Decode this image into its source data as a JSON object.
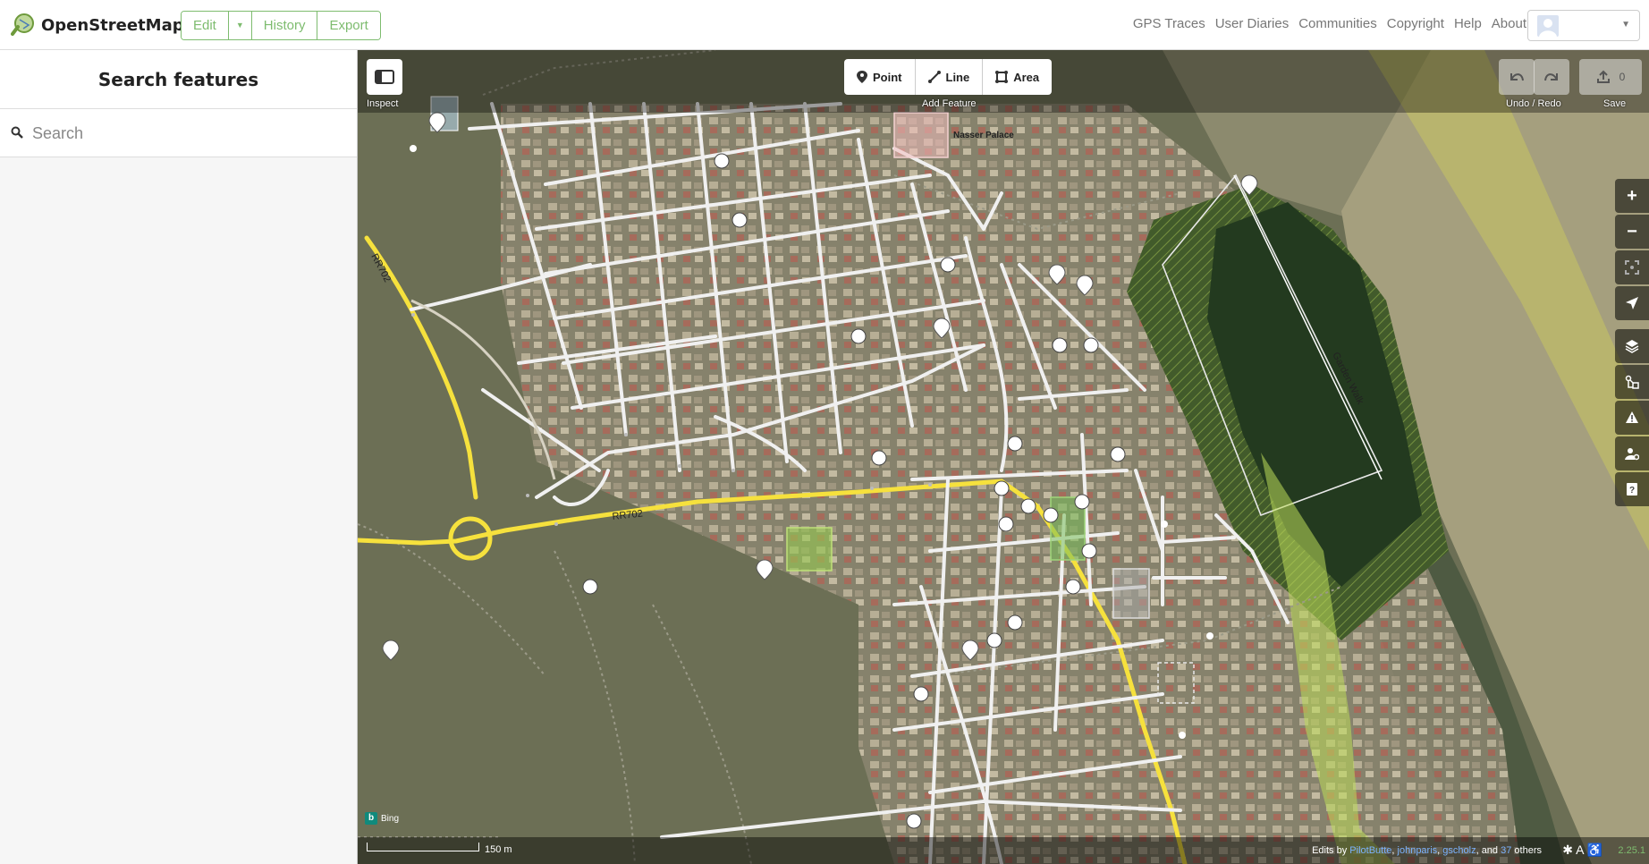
{
  "nav": {
    "logo_text": "OpenStreetMap",
    "edit_label": "Edit",
    "history_label": "History",
    "export_label": "Export",
    "links": [
      "GPS Traces",
      "User Diaries",
      "Communities",
      "Copyright",
      "Help",
      "About"
    ]
  },
  "sidebar": {
    "title": "Search features",
    "search_placeholder": "Search"
  },
  "toolbar": {
    "inspect_label": "Inspect",
    "point_label": "Point",
    "line_label": "Line",
    "area_label": "Area",
    "add_feature_label": "Add Feature",
    "undo_redo_label": "Undo / Redo",
    "save_label": "Save",
    "save_count": "0"
  },
  "map": {
    "road_label_1": "RR702",
    "road_label_2": "RR702",
    "garden_walk_label": "Garden Walk",
    "place_label": "Nasser Palace",
    "imagery_label": "Bing",
    "scale_label": "150 m",
    "attribution_prefix": "Edits by",
    "contributors": [
      "PilotButte",
      "johnparis",
      "gscholz"
    ],
    "attribution_and": ", and",
    "others_count": "37",
    "others_label": "others",
    "version": "2.25.1"
  },
  "colors": {
    "accent": "#7ebc6f",
    "road_primary": "#f6e13d",
    "road_residential": "#ffffff",
    "wood": "#96b43c"
  }
}
